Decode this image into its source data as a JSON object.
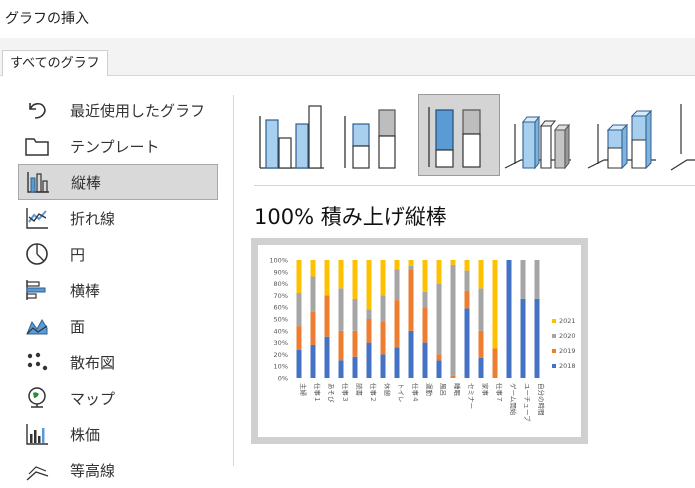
{
  "window": {
    "title": "グラフの挿入"
  },
  "tabs": [
    {
      "label": "すべてのグラフ"
    }
  ],
  "sidebar": {
    "items": [
      {
        "label": "最近使用したグラフ",
        "icon": "undo-icon",
        "selected": false
      },
      {
        "label": "テンプレート",
        "icon": "folder-icon",
        "selected": false
      },
      {
        "label": "縦棒",
        "icon": "column-chart-icon",
        "selected": true
      },
      {
        "label": "折れ線",
        "icon": "line-chart-icon",
        "selected": false
      },
      {
        "label": "円",
        "icon": "pie-chart-icon",
        "selected": false
      },
      {
        "label": "横棒",
        "icon": "bar-chart-icon",
        "selected": false
      },
      {
        "label": "面",
        "icon": "area-chart-icon",
        "selected": false
      },
      {
        "label": "散布図",
        "icon": "scatter-chart-icon",
        "selected": false
      },
      {
        "label": "マップ",
        "icon": "map-icon",
        "selected": false
      },
      {
        "label": "株価",
        "icon": "stock-chart-icon",
        "selected": false
      },
      {
        "label": "等高線",
        "icon": "surface-chart-icon",
        "selected": false
      }
    ]
  },
  "subtypes": [
    {
      "name": "clustered-column",
      "selected": false
    },
    {
      "name": "stacked-column",
      "selected": false
    },
    {
      "name": "100-stacked-column",
      "selected": true
    },
    {
      "name": "3d-clustered-column",
      "selected": false
    },
    {
      "name": "3d-stacked-column",
      "selected": false
    },
    {
      "name": "3d-100-stacked-column",
      "selected": false
    }
  ],
  "selected_chart_name": "100% 積み上げ縦棒",
  "colors": {
    "2018": "#4472c4",
    "2019": "#ed7d31",
    "2020": "#a5a5a5",
    "2021": "#ffc000",
    "selected_bg": "#d9d9d9",
    "icon_blue": "#5b9bd5"
  },
  "chart_data": {
    "type": "bar",
    "stacked": "percent",
    "categories": [
      "主婦",
      "仕事１",
      "あそび",
      "仕事３",
      "読書",
      "仕事２",
      "休憩",
      "トイレ",
      "仕事４",
      "運動",
      "風呂",
      "睡眠",
      "セミナー",
      "家事",
      "仕事７",
      "ゲーム開始",
      "ユーチューブ",
      "自分の時間"
    ],
    "series": [
      {
        "name": "2018",
        "values": [
          24,
          28,
          35,
          15,
          18,
          30,
          20,
          26,
          40,
          30,
          15,
          0,
          59,
          17,
          0,
          100,
          67,
          67
        ]
      },
      {
        "name": "2019",
        "values": [
          20,
          28,
          35,
          25,
          22,
          20,
          28,
          40,
          52,
          30,
          5,
          2,
          15,
          23,
          25,
          0,
          0,
          0
        ]
      },
      {
        "name": "2020",
        "values": [
          28,
          30,
          0,
          36,
          27,
          8,
          22,
          26,
          3,
          13,
          60,
          94,
          17,
          36,
          0,
          0,
          33,
          33
        ]
      },
      {
        "name": "2021",
        "values": [
          28,
          14,
          30,
          24,
          33,
          42,
          30,
          8,
          5,
          27,
          20,
          4,
          9,
          24,
          75,
          0,
          0,
          0
        ]
      }
    ],
    "y_ticks": [
      "0%",
      "10%",
      "20%",
      "30%",
      "40%",
      "50%",
      "60%",
      "70%",
      "80%",
      "90%",
      "100%"
    ],
    "ylim": [
      0,
      100
    ],
    "legend": [
      "2021",
      "2020",
      "2019",
      "2018"
    ],
    "legend_position": "right",
    "grid": false
  }
}
